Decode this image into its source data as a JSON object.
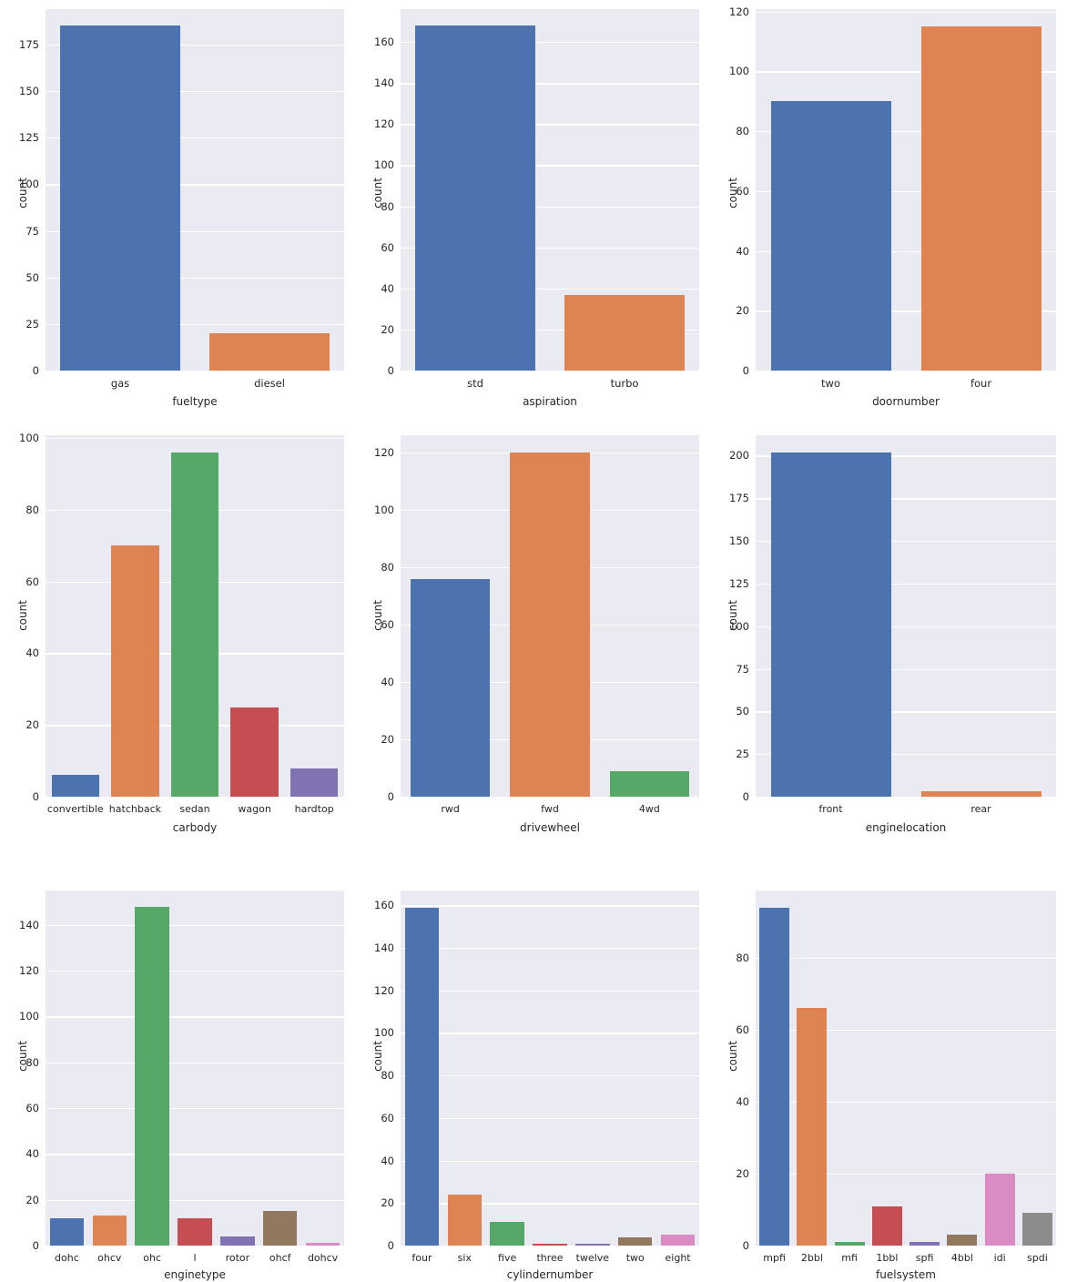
{
  "figure": {
    "type": "figure-grid",
    "rows": 3,
    "cols": 3,
    "background": "#ffffff",
    "axes_background": "#eaeaf2",
    "grid_color": "#ffffff",
    "palette": [
      "#4c72b0",
      "#dd8452",
      "#55a868",
      "#c44e52",
      "#8172b3",
      "#937860",
      "#da8bc3",
      "#8c8c8c",
      "#ccb974"
    ]
  },
  "chart_data": [
    {
      "type": "bar",
      "id": "fueltype",
      "title": "",
      "xlabel": "fueltype",
      "ylabel": "count",
      "categories": [
        "gas",
        "diesel"
      ],
      "values": [
        185,
        20
      ],
      "colors": [
        "#4c72b0",
        "#dd8452"
      ],
      "yticks": [
        0,
        25,
        50,
        75,
        100,
        125,
        150,
        175
      ],
      "yticklabels": [
        "0",
        "25",
        "50",
        "75",
        "100",
        "125",
        "150",
        "175"
      ],
      "ylim": [
        0,
        194
      ],
      "grid": true
    },
    {
      "type": "bar",
      "id": "aspiration",
      "title": "",
      "xlabel": "aspiration",
      "ylabel": "count",
      "categories": [
        "std",
        "turbo"
      ],
      "values": [
        168,
        37
      ],
      "colors": [
        "#4c72b0",
        "#dd8452"
      ],
      "yticks": [
        0,
        20,
        40,
        60,
        80,
        100,
        120,
        140,
        160
      ],
      "yticklabels": [
        "0",
        "20",
        "40",
        "60",
        "80",
        "100",
        "120",
        "140",
        "160"
      ],
      "ylim": [
        0,
        176
      ],
      "grid": true
    },
    {
      "type": "bar",
      "id": "doornumber",
      "title": "",
      "xlabel": "doornumber",
      "ylabel": "count",
      "categories": [
        "two",
        "four"
      ],
      "values": [
        90,
        115
      ],
      "colors": [
        "#4c72b0",
        "#dd8452"
      ],
      "yticks": [
        0,
        20,
        40,
        60,
        80,
        100,
        120
      ],
      "yticklabels": [
        "0",
        "20",
        "40",
        "60",
        "80",
        "100",
        "120"
      ],
      "ylim": [
        0,
        120.8
      ],
      "grid": true
    },
    {
      "type": "bar",
      "id": "carbody",
      "title": "",
      "xlabel": "carbody",
      "ylabel": "count",
      "categories": [
        "convertible",
        "hatchback",
        "sedan",
        "wagon",
        "hardtop"
      ],
      "values": [
        6,
        70,
        96,
        25,
        8
      ],
      "colors": [
        "#4c72b0",
        "#dd8452",
        "#55a868",
        "#c44e52",
        "#8172b3"
      ],
      "yticks": [
        0,
        20,
        40,
        60,
        80,
        100
      ],
      "yticklabels": [
        "0",
        "20",
        "40",
        "60",
        "80",
        "100"
      ],
      "ylim": [
        0,
        100.8
      ],
      "grid": true
    },
    {
      "type": "bar",
      "id": "drivewheel",
      "title": "",
      "xlabel": "drivewheel",
      "ylabel": "count",
      "categories": [
        "rwd",
        "fwd",
        "4wd"
      ],
      "values": [
        76,
        120,
        9
      ],
      "colors": [
        "#4c72b0",
        "#dd8452",
        "#55a868"
      ],
      "yticks": [
        0,
        20,
        40,
        60,
        80,
        100,
        120
      ],
      "yticklabels": [
        "0",
        "20",
        "40",
        "60",
        "80",
        "100",
        "120"
      ],
      "ylim": [
        0,
        126
      ],
      "grid": true
    },
    {
      "type": "bar",
      "id": "enginelocation",
      "title": "",
      "xlabel": "enginelocation",
      "ylabel": "count",
      "categories": [
        "front",
        "rear"
      ],
      "values": [
        202,
        3
      ],
      "colors": [
        "#4c72b0",
        "#dd8452"
      ],
      "yticks": [
        0,
        25,
        50,
        75,
        100,
        125,
        150,
        175,
        200
      ],
      "yticklabels": [
        "0",
        "25",
        "50",
        "75",
        "100",
        "125",
        "150",
        "175",
        "200"
      ],
      "ylim": [
        0,
        212
      ],
      "grid": true
    },
    {
      "type": "bar",
      "id": "enginetype",
      "title": "",
      "xlabel": "enginetype",
      "ylabel": "count",
      "categories": [
        "dohc",
        "ohcv",
        "ohc",
        "l",
        "rotor",
        "ohcf",
        "dohcv"
      ],
      "values": [
        12,
        13,
        148,
        12,
        4,
        15,
        1
      ],
      "colors": [
        "#4c72b0",
        "#dd8452",
        "#55a868",
        "#c44e52",
        "#8172b3",
        "#937860",
        "#da8bc3"
      ],
      "yticks": [
        0,
        20,
        40,
        60,
        80,
        100,
        120,
        140
      ],
      "yticklabels": [
        "0",
        "20",
        "40",
        "60",
        "80",
        "100",
        "120",
        "140"
      ],
      "ylim": [
        0,
        155
      ],
      "grid": true
    },
    {
      "type": "bar",
      "id": "cylindernumber",
      "title": "",
      "xlabel": "cylindernumber",
      "ylabel": "count",
      "categories": [
        "four",
        "six",
        "five",
        "three",
        "twelve",
        "two",
        "eight"
      ],
      "values": [
        159,
        24,
        11,
        1,
        1,
        4,
        5
      ],
      "colors": [
        "#4c72b0",
        "#dd8452",
        "#55a868",
        "#c44e52",
        "#8172b3",
        "#937860",
        "#da8bc3"
      ],
      "yticks": [
        0,
        20,
        40,
        60,
        80,
        100,
        120,
        140,
        160
      ],
      "yticklabels": [
        "0",
        "20",
        "40",
        "60",
        "80",
        "100",
        "120",
        "140",
        "160"
      ],
      "ylim": [
        0,
        167
      ],
      "grid": true
    },
    {
      "type": "bar",
      "id": "fuelsystem",
      "title": "",
      "xlabel": "fuelsystem",
      "ylabel": "count",
      "categories": [
        "mpfi",
        "2bbl",
        "mfi",
        "1bbl",
        "spfi",
        "4bbl",
        "idi",
        "spdi"
      ],
      "values": [
        94,
        66,
        1,
        11,
        1,
        3,
        20,
        9
      ],
      "colors": [
        "#4c72b0",
        "#dd8452",
        "#55a868",
        "#c44e52",
        "#8172b3",
        "#937860",
        "#da8bc3",
        "#8c8c8c"
      ],
      "yticks": [
        0,
        20,
        40,
        60,
        80
      ],
      "yticklabels": [
        "0",
        "20",
        "40",
        "60",
        "80"
      ],
      "ylim": [
        0,
        98.7
      ],
      "grid": true
    }
  ]
}
